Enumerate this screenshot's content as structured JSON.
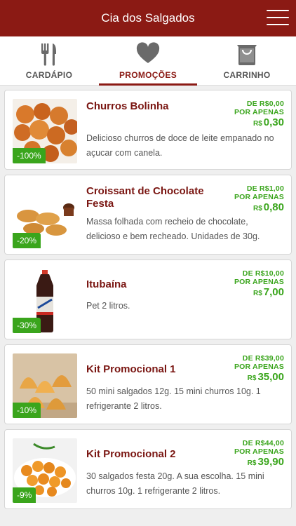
{
  "header": {
    "title": "Cia dos Salgados"
  },
  "tabs": [
    {
      "label": "CARDÁPIO",
      "icon": "cutlery-icon"
    },
    {
      "label": "PROMOÇÕES",
      "icon": "heart-icon"
    },
    {
      "label": "CARRINHO",
      "icon": "shopping-bag-icon"
    }
  ],
  "colors": {
    "brand": "#8b1a14",
    "accent_green": "#3aa51c"
  },
  "products": [
    {
      "name": "Churros Bolinha",
      "description": "Delicioso churros de doce de leite empanado no açucar com canela.",
      "from": "DE R$0,00",
      "only": "POR APENAS",
      "currency": "R$",
      "price": "0,30",
      "discount": "-100%"
    },
    {
      "name": "Croissant de Chocolate Festa",
      "description": "Massa folhada com recheio de chocolate, delicioso e bem recheado. Unidades de 30g.",
      "from": "DE R$1,00",
      "only": "POR APENAS",
      "currency": "R$",
      "price": "0,80",
      "discount": "-20%"
    },
    {
      "name": "Itubaína",
      "description": "Pet 2 litros.",
      "from": "DE R$10,00",
      "only": "POR APENAS",
      "currency": "R$",
      "price": "7,00",
      "discount": "-30%"
    },
    {
      "name": "Kit Promocional 1",
      "description": "50 mini salgados 12g. 15 mini churros 10g. 1 refrigerante 2 litros.",
      "from": "DE R$39,00",
      "only": "POR APENAS",
      "currency": "R$",
      "price": "35,00",
      "discount": "-10%"
    },
    {
      "name": "Kit Promocional 2",
      "description": "30 salgados festa 20g. A sua escolha. 15 mini churros 10g. 1 refrigerante 2 litros.",
      "from": "DE R$44,00",
      "only": "POR APENAS",
      "currency": "R$",
      "price": "39,90",
      "discount": "-9%"
    }
  ]
}
